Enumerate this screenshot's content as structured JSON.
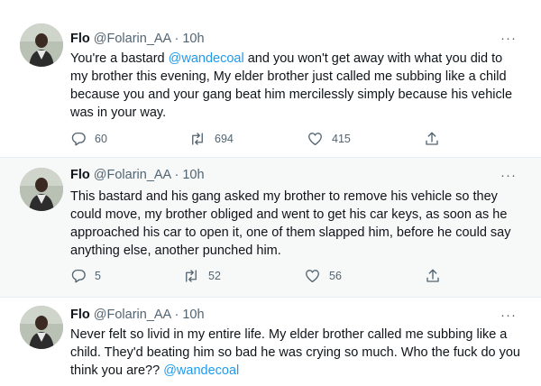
{
  "tweets": [
    {
      "name": "Flo",
      "handle": "@Folarin_AA",
      "separator": "·",
      "time": "10h",
      "more": "···",
      "text_a": "You're a bastard ",
      "mention": "@wandecoal",
      "text_b": " and you won't get away with what you did to my brother this evening, My elder brother just called me subbing like a child because you and your gang beat him mercilessly simply because his vehicle was in your way.",
      "replies": "60",
      "retweets": "694",
      "likes": "415"
    },
    {
      "name": "Flo",
      "handle": "@Folarin_AA",
      "separator": "·",
      "time": "10h",
      "more": "···",
      "text": "This bastard and his gang asked my brother to remove his vehicle so they could move, my brother obliged and went to get his car keys, as soon as he approached his car to open it, one of them slapped him, before he could say anything else, another punched him.",
      "replies": "5",
      "retweets": "52",
      "likes": "56"
    },
    {
      "name": "Flo",
      "handle": "@Folarin_AA",
      "separator": "·",
      "time": "10h",
      "more": "···",
      "text_a": "Never felt so livid in my entire life. My elder brother called me subbing like a child. They'd beating him so bad he was crying so much. Who the fuck do you think you are?? ",
      "mention": "@wandecoal"
    }
  ],
  "icons": {
    "reply": "reply-bubble-icon",
    "retweet": "retweet-icon",
    "like": "heart-icon",
    "share": "share-upload-icon",
    "more": "more-dots-icon"
  },
  "colors": {
    "link": "#1d9bf0",
    "muted": "#536471",
    "text": "#0f1419",
    "highlight_bg": "#f7f9f9"
  }
}
